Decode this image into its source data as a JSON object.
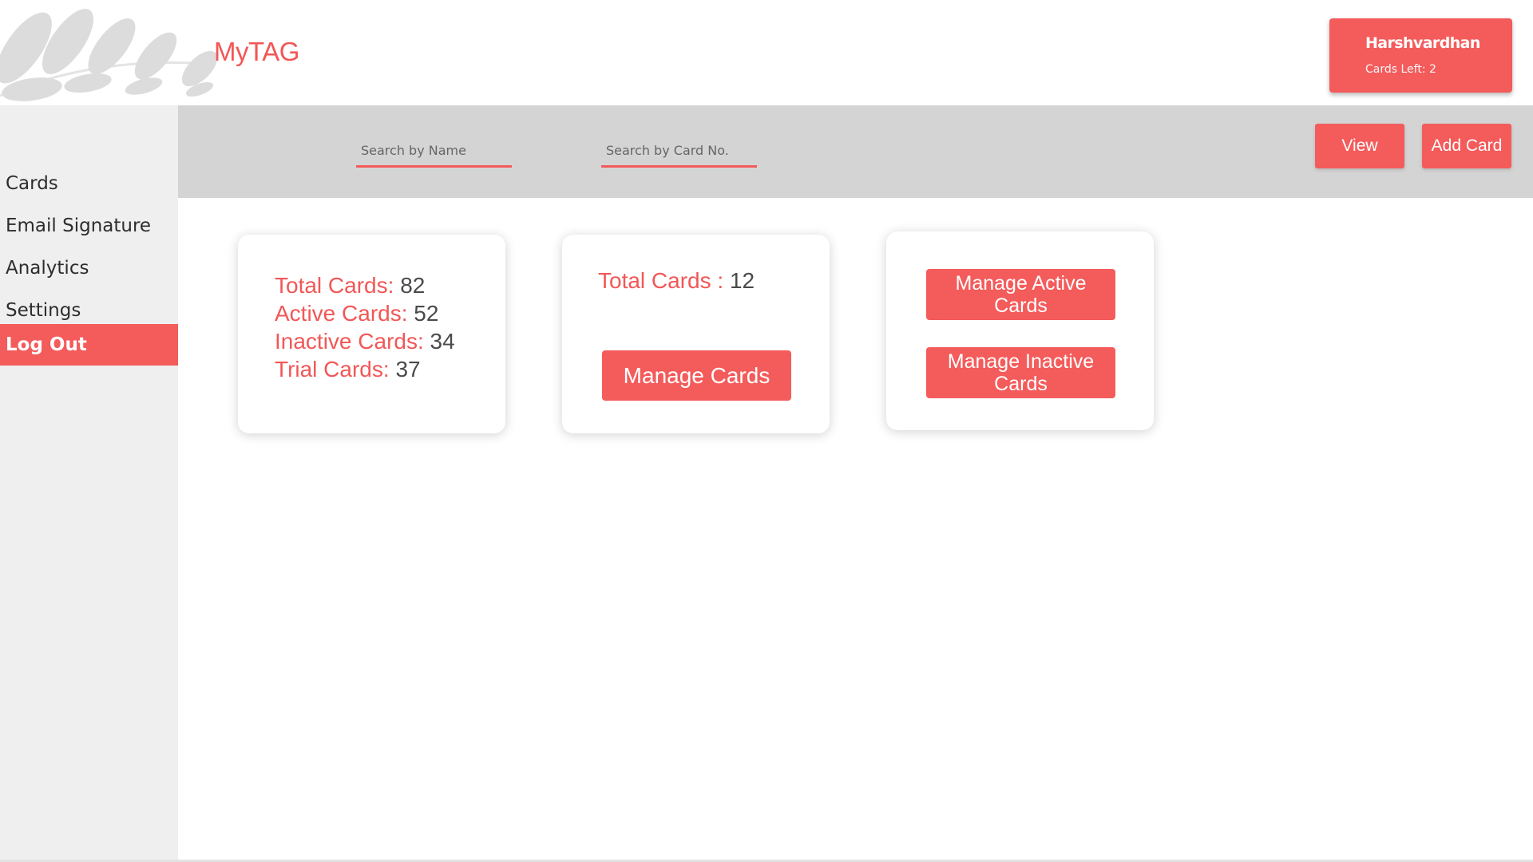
{
  "brand": {
    "name": "MyTAG"
  },
  "user": {
    "name": "Harshvardhan",
    "cards_left": "Cards Left: 2"
  },
  "sidebar": {
    "items": [
      {
        "label": "Cards"
      },
      {
        "label": "Email Signature"
      },
      {
        "label": "Analytics"
      },
      {
        "label": "Settings"
      },
      {
        "label": "Log Out",
        "active": true
      }
    ]
  },
  "toolbar": {
    "search_name_placeholder": "Search by Name",
    "search_card_placeholder": "Search by Card No.",
    "view_label": "View",
    "add_card_label": "Add Card"
  },
  "summary": {
    "stats": [
      {
        "label": "Total Cards:",
        "value": "82"
      },
      {
        "label": "Active Cards:",
        "value": "52"
      },
      {
        "label": "Inactive Cards:",
        "value": "34"
      },
      {
        "label": "Trial Cards:",
        "value": "37"
      }
    ]
  },
  "manage_panel": {
    "total_label": "Total Cards :",
    "total_value": "12",
    "button_label": "Manage Cards"
  },
  "actions_panel": {
    "active_label": "Manage Active Cards",
    "inactive_label": "Manage Inactive Cards"
  },
  "colors": {
    "accent": "#f45b5b",
    "toolbar_bg": "#d4d4d4",
    "sidebar_bg": "#efefef"
  }
}
